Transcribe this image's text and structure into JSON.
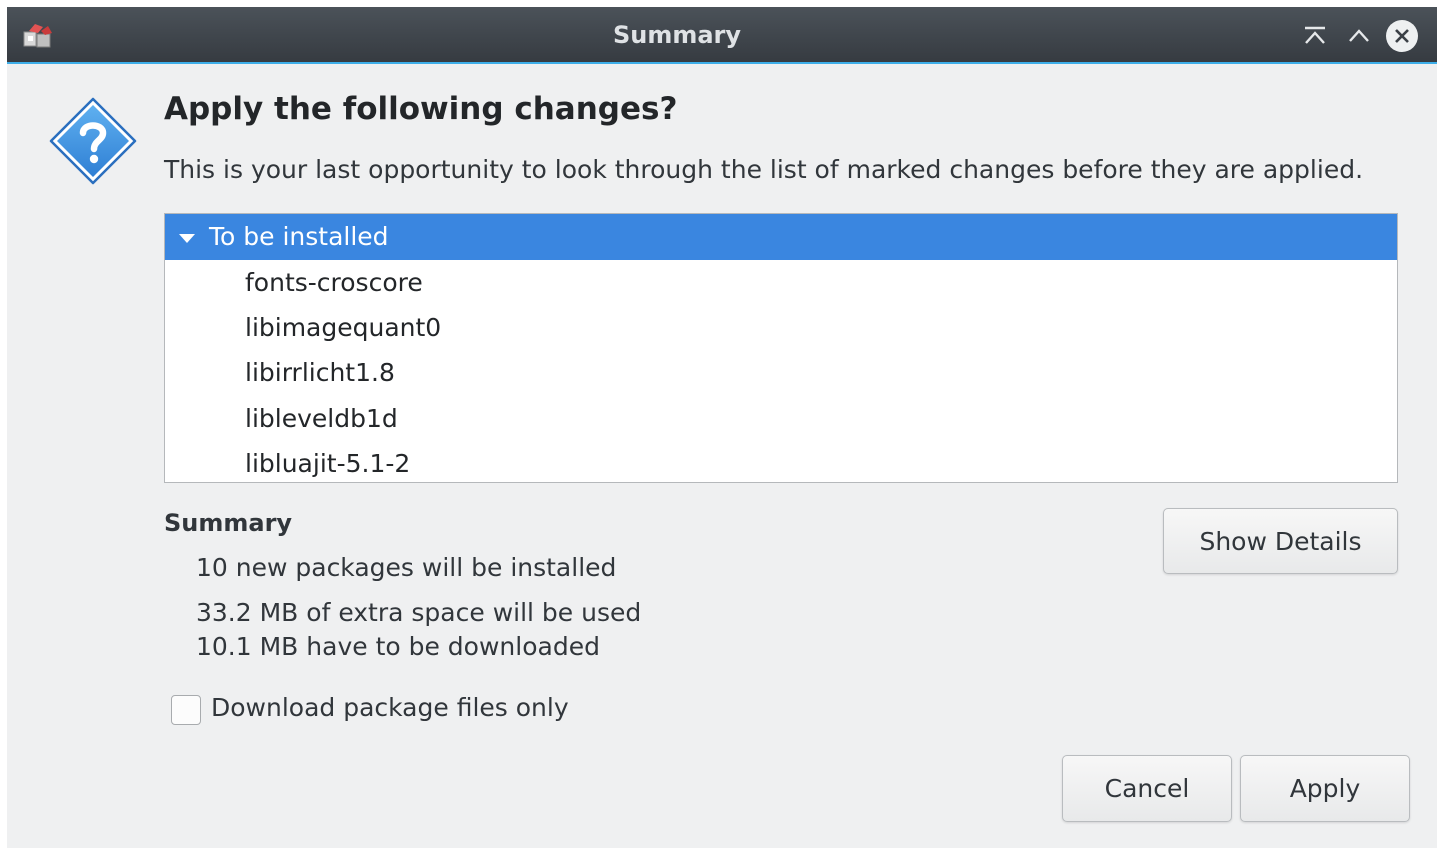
{
  "window": {
    "title": "Summary",
    "accent_color": "#3daee9",
    "titlebar_color": "#3d4349",
    "buttons": [
      "keep-above-icon",
      "maximize-icon",
      "close-icon"
    ]
  },
  "dialog": {
    "icon": "question-icon",
    "heading": "Apply the following changes?",
    "description": "This is your last opportunity to look through the list of marked changes before they are applied."
  },
  "changes": {
    "group_label": "To be installed",
    "selection_color": "#3a86e0",
    "items": [
      "fonts-croscore",
      "libimagequant0",
      "libirrlicht1.8",
      "libleveldb1d",
      "libluajit-5.1-2"
    ]
  },
  "summary": {
    "title": "Summary",
    "lines": [
      "10 new packages will be installed",
      "33.2 MB of extra space will be used",
      "10.1 MB have to be downloaded"
    ],
    "show_details_label": "Show Details"
  },
  "options": {
    "download_only_label": "Download package files only",
    "download_only_checked": false
  },
  "actions": {
    "cancel_label": "Cancel",
    "apply_label": "Apply"
  }
}
